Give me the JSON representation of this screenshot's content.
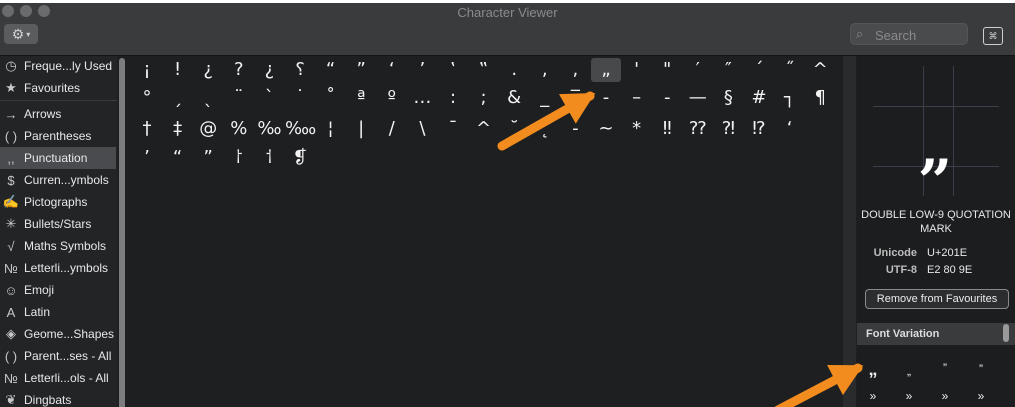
{
  "window": {
    "title": "Character Viewer"
  },
  "toolbar": {
    "gear_icon": "gear-icon",
    "search_placeholder": "Search",
    "keyboard_icon": "keyboard-viewer-icon"
  },
  "sidebar": {
    "items": [
      {
        "label": "Freque...ly Used",
        "icon": "◷"
      },
      {
        "label": "Favourites",
        "icon": "★"
      },
      {
        "label": "Arrows",
        "icon": "→"
      },
      {
        "label": "Parentheses",
        "icon": "( )"
      },
      {
        "label": "Punctuation",
        "icon": ",,"
      },
      {
        "label": "Curren...ymbols",
        "icon": "$"
      },
      {
        "label": "Pictographs",
        "icon": "✍"
      },
      {
        "label": "Bullets/Stars",
        "icon": "✳"
      },
      {
        "label": "Maths Symbols",
        "icon": "√"
      },
      {
        "label": "Letterli...ymbols",
        "icon": "№"
      },
      {
        "label": "Emoji",
        "icon": "☺"
      },
      {
        "label": "Latin",
        "icon": "A"
      },
      {
        "label": "Geome...Shapes",
        "icon": "◈"
      },
      {
        "label": "Parent...ses - All",
        "icon": "( )"
      },
      {
        "label": "Letterli...ols - All",
        "icon": "№"
      },
      {
        "label": "Dingbats",
        "icon": "❦"
      }
    ],
    "selected": "Punctuation"
  },
  "grid": {
    "rows": [
      [
        "¡",
        "!",
        "¿",
        "?",
        "¿",
        "⸮",
        "“",
        "”",
        "‘",
        "’",
        "‛",
        "‟",
        ".",
        ",",
        ",",
        "„",
        "'",
        "\"",
        "′",
        "″",
        "´",
        "˝",
        "^"
      ],
      [
        "°",
        "ˏ",
        "ˎ",
        "¨",
        "`",
        "˙",
        "˚",
        "ª",
        "º",
        "…",
        ":",
        ";",
        "&",
        "_",
        "‾",
        "-",
        "–",
        "-",
        "—",
        "§",
        "#",
        "┐",
        "¶"
      ],
      [
        "†",
        "‡",
        "@",
        "%",
        "‰",
        "‱",
        "¦",
        "|",
        "/",
        "\\",
        "¯",
        "^",
        "˘",
        "˛",
        "-",
        "~",
        "*",
        "‼",
        "⁇",
        "⁈",
        "⁉",
        "‘"
      ],
      [
        "’",
        "“",
        "”",
        "⸷",
        "⸶",
        "❡"
      ]
    ],
    "selected_char": "„"
  },
  "preview": {
    "glyph": "„",
    "name": "DOUBLE LOW-9 QUOTATION MARK",
    "unicode_label": "Unicode",
    "unicode_value": "U+201E",
    "utf8_label": "UTF-8",
    "utf8_value": "E2 80 9E",
    "remove_label": "Remove from Favourites"
  },
  "font_variation": {
    "header": "Font Variation",
    "chars": [
      "„",
      "„",
      "”",
      "”",
      "»",
      "»",
      "»",
      "»"
    ]
  },
  "annotations": {
    "arrow_color": "#f28c1e"
  }
}
